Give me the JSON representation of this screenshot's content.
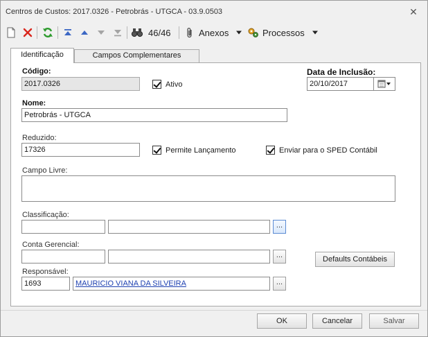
{
  "window": {
    "title": "Centros de Custos: 2017.0326 - Petrobrás - UTGCA - 03.9.0503"
  },
  "toolbar": {
    "record_counter": "46/46",
    "attachments_label": "Anexos",
    "processes_label": "Processos"
  },
  "tabs": [
    {
      "label": "Identificação"
    },
    {
      "label": "Campos Complementares"
    }
  ],
  "form": {
    "codigo_label": "Código:",
    "codigo_value": "2017.0326",
    "ativo_label": "Ativo",
    "data_inclusao_label": "Data de Inclusão:",
    "data_inclusao_value": "20/10/2017",
    "nome_label": "Nome:",
    "nome_value": "Petrobrás - UTGCA",
    "reduzido_label": "Reduzido:",
    "reduzido_value": "17326",
    "permite_lancamento_label": "Permite Lançamento",
    "enviar_sped_label": "Enviar para o SPED Contábil",
    "campo_livre_label": "Campo Livre:",
    "campo_livre_value": "",
    "classificacao_label": "Classificação:",
    "classificacao_code": "",
    "classificacao_desc": "",
    "conta_gerencial_label": "Conta Gerencial:",
    "conta_gerencial_code": "",
    "conta_gerencial_desc": "",
    "responsavel_label": "Responsável:",
    "responsavel_code": "1693",
    "responsavel_name": "MAURICIO VIANA DA SILVEIRA",
    "lookup_label": "...",
    "defaults_contabeis_label": "Defaults Contábeis"
  },
  "footer": {
    "ok_label": "OK",
    "cancel_label": "Cancelar",
    "save_label": "Salvar"
  },
  "checkboxes": {
    "ativo": true,
    "permite_lancamento": true,
    "enviar_sped": true
  },
  "colors": {
    "link": "#1c3fb0",
    "delete_red": "#d9261c",
    "refresh_green": "#2e9b2e",
    "nav_blue": "#3b67c4"
  }
}
